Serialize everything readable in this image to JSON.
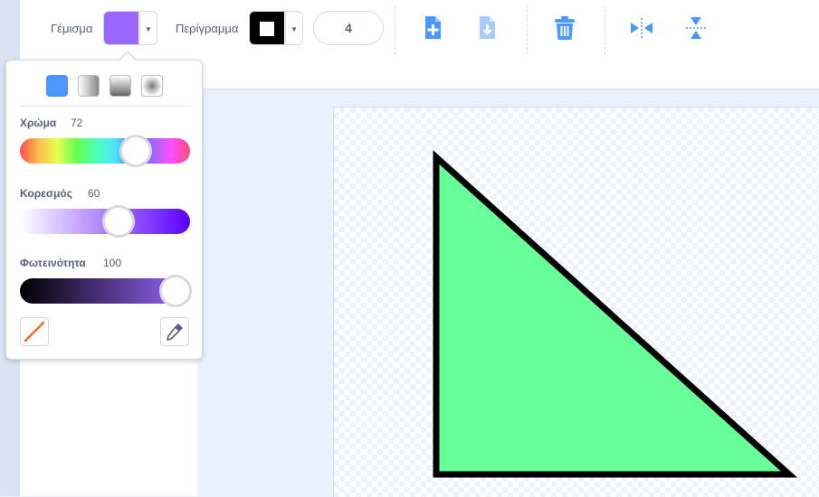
{
  "toolbar": {
    "fill_label": "Γέμισμα",
    "fill_color": "#9966ff",
    "outline_label": "Περίγραμμα",
    "outline_color": "#000000",
    "outline_width": "4",
    "icons": [
      "new-costume-icon",
      "import-costume-icon",
      "delete-icon",
      "flip-horizontal-icon",
      "flip-vertical-icon"
    ]
  },
  "color_picker": {
    "gradient_options": [
      "solid",
      "horizontal-gradient",
      "vertical-gradient",
      "radial-gradient"
    ],
    "sliders": [
      {
        "label": "Χρώμα",
        "value": "72"
      },
      {
        "label": "Κορεσμός",
        "value": "60"
      },
      {
        "label": "Φωτεινότητα",
        "value": "100"
      }
    ],
    "actions": [
      "no-color",
      "eyedropper"
    ]
  },
  "canvas": {
    "shape": "triangle",
    "fill_color": "#66ff99",
    "stroke_color": "#000000"
  }
}
